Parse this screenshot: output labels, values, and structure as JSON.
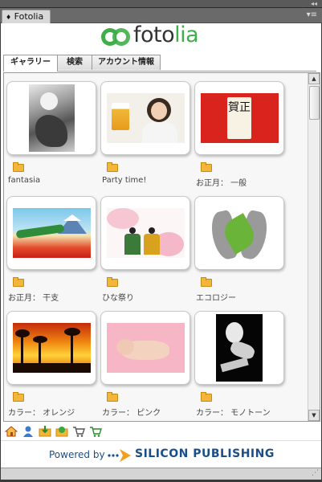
{
  "panel": {
    "title": "Fotolia"
  },
  "logo": {
    "text_a": "foto",
    "text_b": "lia"
  },
  "tabs": [
    {
      "label": "ギャラリー"
    },
    {
      "label": "検索"
    },
    {
      "label": "アカウント情報"
    }
  ],
  "gallery": {
    "items": [
      {
        "caption": "fantasia"
      },
      {
        "caption": "Party time!"
      },
      {
        "caption": "お正月： 一般"
      },
      {
        "caption": "お正月： 干支"
      },
      {
        "caption": "ひな祭り"
      },
      {
        "caption": "エコロジー"
      },
      {
        "caption": "カラー： オレンジ"
      },
      {
        "caption": "カラー： ピンク"
      },
      {
        "caption": "カラー： モノトーン"
      }
    ]
  },
  "thumb_texts": {
    "newyear_card": "賀正"
  },
  "footer": {
    "powered_by": "Powered by",
    "brand": "SILICON PUBLISHING"
  },
  "colors": {
    "logo_green": "#3fae49",
    "brand_blue": "#1a4e8a",
    "folder": "#f4b63a"
  }
}
